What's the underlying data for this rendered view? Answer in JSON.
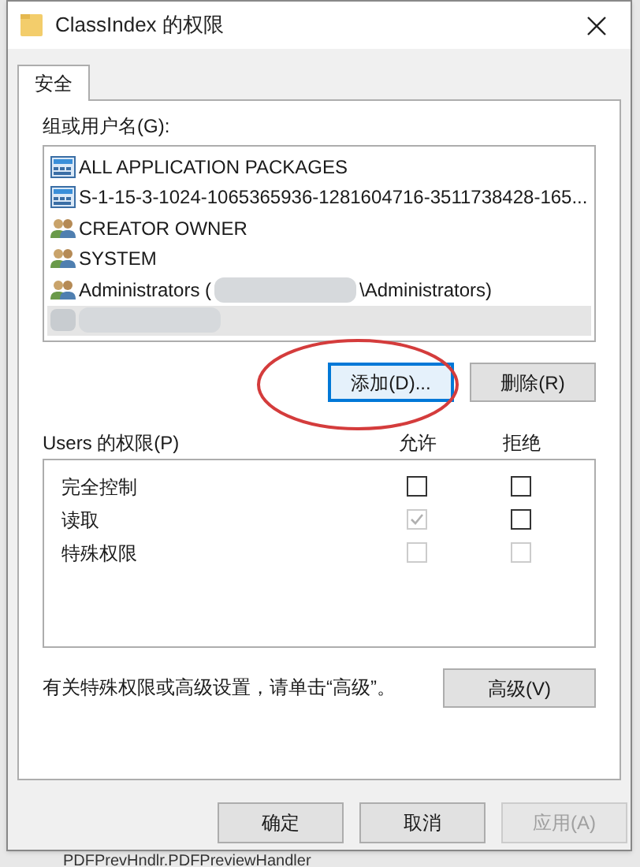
{
  "window": {
    "title": "ClassIndex 的权限"
  },
  "tabs": [
    {
      "label": "安全",
      "selected": true
    }
  ],
  "group_list": {
    "label": "组或用户名(G):",
    "items": [
      {
        "kind": "package",
        "parts": [
          {
            "kind": "text",
            "text": "ALL APPLICATION PACKAGES"
          }
        ],
        "selected": false
      },
      {
        "kind": "package",
        "parts": [
          {
            "kind": "text",
            "text": "S-1-15-3-1024-1065365936-1281604716-3511738428-165..."
          }
        ],
        "selected": false
      },
      {
        "kind": "group",
        "parts": [
          {
            "kind": "text",
            "text": "CREATOR OWNER"
          }
        ],
        "selected": false
      },
      {
        "kind": "group",
        "parts": [
          {
            "kind": "text",
            "text": "SYSTEM"
          }
        ],
        "selected": false
      },
      {
        "kind": "group",
        "parts": [
          {
            "kind": "text",
            "text": "Administrators ("
          },
          {
            "kind": "redacted"
          },
          {
            "kind": "text",
            "text": "\\Administrators)"
          }
        ],
        "selected": false
      },
      {
        "kind": "redacted",
        "parts": [
          {
            "kind": "redacted"
          }
        ],
        "selected": true
      }
    ]
  },
  "list_buttons": [
    {
      "label": "添加(D)...",
      "focused": true
    },
    {
      "label": "删除(R)",
      "focused": false
    }
  ],
  "highlight": {
    "kind": "ellipse"
  },
  "permissions": {
    "label": "Users 的权限(P)",
    "allow_header": "允许",
    "deny_header": "拒绝",
    "rows": [
      {
        "name": "完全控制",
        "allow": {
          "checked": false,
          "disabled": false
        },
        "deny": {
          "checked": false,
          "disabled": false
        }
      },
      {
        "name": "读取",
        "allow": {
          "checked": true,
          "disabled": true
        },
        "deny": {
          "checked": false,
          "disabled": false
        }
      },
      {
        "name": "特殊权限",
        "allow": {
          "checked": false,
          "disabled": true
        },
        "deny": {
          "checked": false,
          "disabled": true
        }
      }
    ]
  },
  "advanced_hint": "有关特殊权限或高级设置，请单击“高级”。",
  "advanced_button": "高级(V)",
  "footer_buttons": [
    {
      "label": "确定",
      "disabled": false
    },
    {
      "label": "取消",
      "disabled": false
    },
    {
      "label": "应用(A)",
      "disabled": true
    }
  ],
  "background_item": "PDFPrevHndlr.PDFPreviewHandler"
}
